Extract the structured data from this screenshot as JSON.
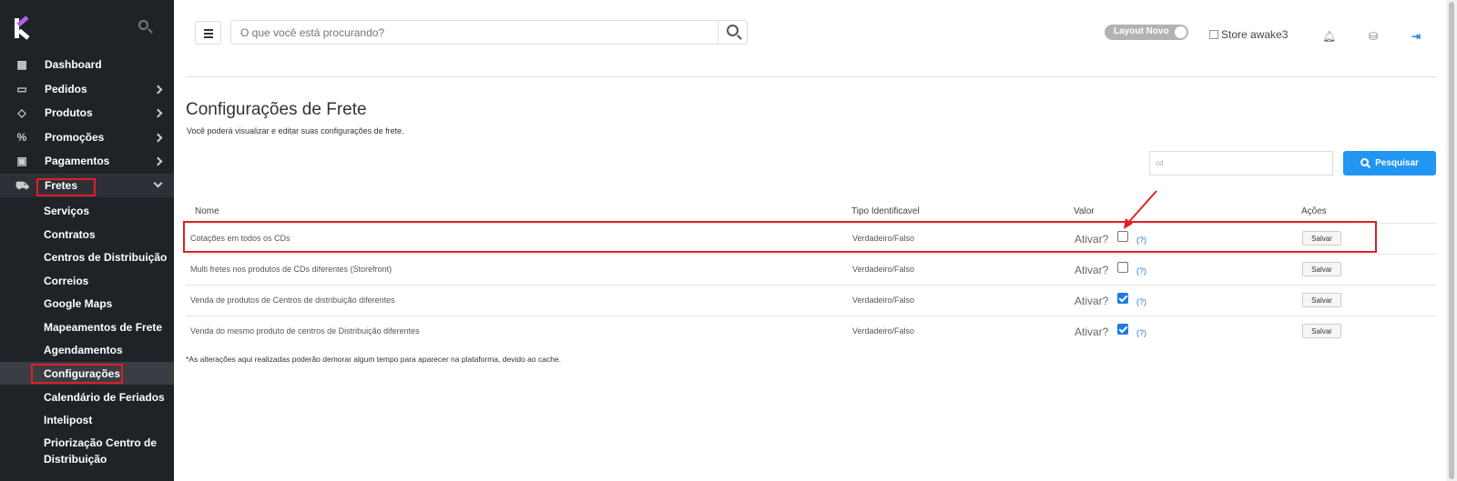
{
  "sidebar": {
    "items": [
      {
        "label": "Dashboard",
        "icon": "grid-icon"
      },
      {
        "label": "Pedidos",
        "icon": "inbox-icon"
      },
      {
        "label": "Produtos",
        "icon": "tag-icon"
      },
      {
        "label": "Promoções",
        "icon": "percent-icon"
      },
      {
        "label": "Pagamentos",
        "icon": "money-icon"
      },
      {
        "label": "Fretes",
        "icon": "truck-icon"
      }
    ],
    "subitems": [
      "Serviços",
      "Contratos",
      "Centros de Distribuição",
      "Correios",
      "Google Maps",
      "Mapeamentos de Frete",
      "Agendamentos",
      "Configurações",
      "Calendário de Feriados",
      "Intelipost",
      "Priorização Centro de Distribuição"
    ]
  },
  "header": {
    "search_placeholder": "O que você está procurando?",
    "layout_toggle": "Layout Novo",
    "store_alt": "Store awake3"
  },
  "page": {
    "title": "Configurações de Frete",
    "subtitle": "Você poderá visualizar e editar suas configurações de frete.",
    "filter_value": "cd",
    "search_button": "Pesquisar",
    "columns": [
      "Nome",
      "Tipo Identificavel",
      "Valor",
      "Ações"
    ],
    "rows": [
      {
        "name": "Cotações em todos os CDs",
        "type": "Verdadeiro/Falso",
        "ativar": "Ativar?",
        "checked": false,
        "help": "(?)",
        "action": "Salvar"
      },
      {
        "name": "Multi fretes nos produtos de CDs diferentes (Storefront)",
        "type": "Verdadeiro/Falso",
        "ativar": "Ativar?",
        "checked": false,
        "help": "(?)",
        "action": "Salvar"
      },
      {
        "name": "Venda de produtos de Centros de distribuição diferentes",
        "type": "Verdadeiro/Falso",
        "ativar": "Ativar?",
        "checked": true,
        "help": "(?)",
        "action": "Salvar"
      },
      {
        "name": "Venda do mesmo produto de centros de Distribuição diferentes",
        "type": "Verdadeiro/Falso",
        "ativar": "Ativar?",
        "checked": true,
        "help": "(?)",
        "action": "Salvar"
      }
    ],
    "footnote": "*As alterações aqui realizadas poderão demorar algum tempo para aparecer na plataforma, devido ao cache."
  },
  "colors": {
    "sidebar_bg": "#1f2226",
    "accent": "#2196f3",
    "highlight": "#e01f26"
  }
}
